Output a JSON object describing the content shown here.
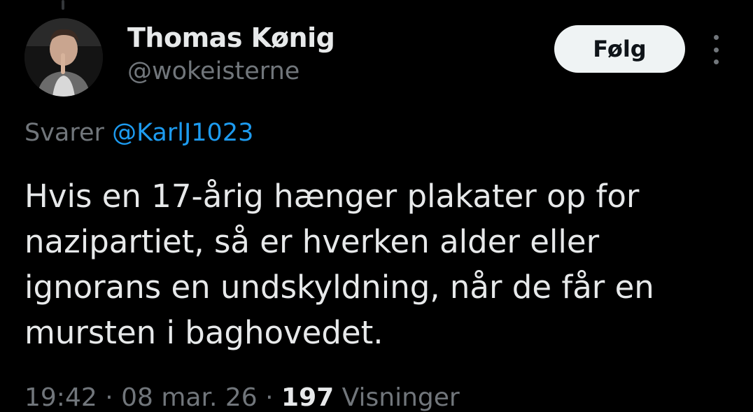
{
  "author": {
    "name": "Thomas Kønig",
    "handle": "@wokeisterne",
    "avatar_icon": "profile-photo"
  },
  "follow_button": {
    "label": "Følg"
  },
  "more_menu": {
    "icon": "more-vertical-icon"
  },
  "reply": {
    "prefix": "Svarer",
    "mention": "@KarlJ1023"
  },
  "tweet": {
    "text_lines": [
      "Hvis en 17-årig hænger plakater op for",
      "nazipartiet, så er hverken alder eller",
      "ignorans en undskyldning, når de får en",
      "mursten i baghovedet."
    ]
  },
  "meta": {
    "time": "19:42",
    "separator": "·",
    "date": "08 mar. 26",
    "views_count": "197",
    "views_label": "Visninger"
  },
  "colors": {
    "background": "#000000",
    "text_primary": "#e7e9ea",
    "text_secondary": "#71767b",
    "link": "#1d9bf0",
    "button_bg": "#eff3f4",
    "button_text": "#0f1419"
  }
}
